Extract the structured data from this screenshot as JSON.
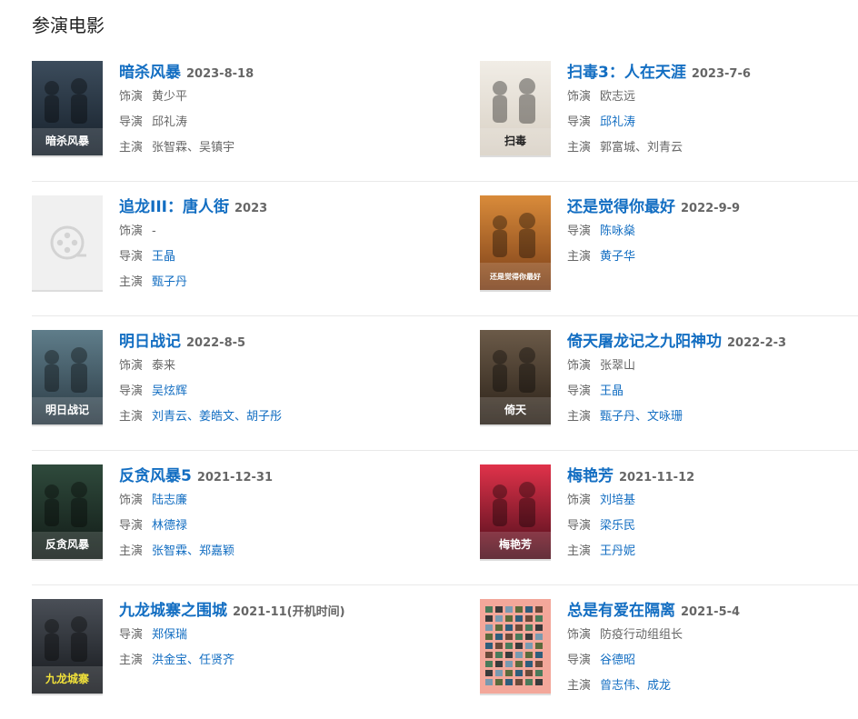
{
  "section": {
    "title": "参演电影"
  },
  "movies": [
    {
      "title": "暗杀风暴",
      "date": "2023-8-18",
      "lines": [
        {
          "label": "饰演",
          "value": "黄少平",
          "kind": "plain"
        },
        {
          "label": "导演",
          "value": "邱礼涛",
          "kind": "plain"
        },
        {
          "label": "主演",
          "value": "张智霖、吴镇宇",
          "kind": "plain"
        }
      ],
      "poster": {
        "kind": "dark",
        "colors": [
          "#3c4c5c",
          "#16202a"
        ],
        "text": "暗杀风暴",
        "text_color": "#ffffff"
      }
    },
    {
      "title": "扫毒3：人在天涯",
      "date": "2023-7-6",
      "lines": [
        {
          "label": "饰演",
          "value": "欧志远",
          "kind": "plain"
        },
        {
          "label": "导演",
          "value": "邱礼涛",
          "kind": "link"
        },
        {
          "label": "主演",
          "value": "郭富城、刘青云",
          "kind": "plain"
        }
      ],
      "poster": {
        "kind": "light",
        "colors": [
          "#f1ede6",
          "#d8d0c4"
        ],
        "text": "扫毒",
        "text_color": "#222222"
      }
    },
    {
      "title": "追龙III：唐人街",
      "date": "2023",
      "lines": [
        {
          "label": "饰演",
          "value": "-",
          "kind": "plain"
        },
        {
          "label": "导演",
          "value": "王晶",
          "kind": "link"
        },
        {
          "label": "主演",
          "value": "甄子丹",
          "kind": "link"
        }
      ],
      "poster": {
        "kind": "placeholder",
        "colors": [
          "#f0f0f0",
          "#f0f0f0"
        ],
        "icon": "film-reel-icon"
      }
    },
    {
      "title": "还是觉得你最好",
      "date": "2022-9-9",
      "lines": [
        {
          "label": "导演",
          "value": "陈咏燊",
          "kind": "link"
        },
        {
          "label": "主演",
          "value": "黄子华",
          "kind": "link"
        }
      ],
      "poster": {
        "kind": "warm",
        "colors": [
          "#d98b3a",
          "#7a3e18"
        ],
        "text": "还是觉得你最好",
        "text_color": "#ffffff"
      }
    },
    {
      "title": "明日战记",
      "date": "2022-8-5",
      "lines": [
        {
          "label": "饰演",
          "value": "泰来",
          "kind": "plain"
        },
        {
          "label": "导演",
          "value": "吴炫辉",
          "kind": "link"
        },
        {
          "label": "主演",
          "value": "刘青云、姜皓文、胡子彤",
          "kind": "link"
        }
      ],
      "poster": {
        "kind": "sci",
        "colors": [
          "#5f7d8a",
          "#2b3a44"
        ],
        "text": "明日战记",
        "text_color": "#ffffff"
      }
    },
    {
      "title": "倚天屠龙记之九阳神功",
      "date": "2022-2-3",
      "lines": [
        {
          "label": "饰演",
          "value": "张翠山",
          "kind": "plain"
        },
        {
          "label": "导演",
          "value": "王晶",
          "kind": "link"
        },
        {
          "label": "主演",
          "value": "甄子丹、文咏珊",
          "kind": "link"
        }
      ],
      "poster": {
        "kind": "epic",
        "colors": [
          "#6b5a48",
          "#2a2118"
        ],
        "text": "倚天",
        "text_color": "#ffffff"
      }
    },
    {
      "title": "反贪风暴5",
      "date": "2021-12-31",
      "lines": [
        {
          "label": "饰演",
          "value": "陆志廉",
          "kind": "link"
        },
        {
          "label": "导演",
          "value": "林德禄",
          "kind": "link"
        },
        {
          "label": "主演",
          "value": "张智霖、郑嘉颖",
          "kind": "link"
        }
      ],
      "poster": {
        "kind": "dark",
        "colors": [
          "#2f4a3c",
          "#111a16"
        ],
        "text": "反贪风暴",
        "text_color": "#ffffff"
      }
    },
    {
      "title": "梅艳芳",
      "date": "2021-11-12",
      "lines": [
        {
          "label": "饰演",
          "value": "刘培基",
          "kind": "link"
        },
        {
          "label": "导演",
          "value": "梁乐民",
          "kind": "link"
        },
        {
          "label": "主演",
          "value": "王丹妮",
          "kind": "link"
        }
      ],
      "poster": {
        "kind": "red",
        "colors": [
          "#e0324a",
          "#4a0d1a"
        ],
        "text": "梅艳芳",
        "text_color": "#ffffff"
      }
    },
    {
      "title": "九龙城寨之围城",
      "date": "2021-11(开机时间)",
      "lines": [
        {
          "label": "导演",
          "value": "郑保瑞",
          "kind": "link"
        },
        {
          "label": "主演",
          "value": "洪金宝、任贤齐",
          "kind": "link"
        }
      ],
      "poster": {
        "kind": "city",
        "colors": [
          "#4a4f57",
          "#15181c"
        ],
        "text": "九龙城寨",
        "text_color": "#f2e23a"
      }
    },
    {
      "title": "总是有爱在隔离",
      "date": "2021-5-4",
      "lines": [
        {
          "label": "饰演",
          "value": "防疫行动组组长",
          "kind": "plain"
        },
        {
          "label": "导演",
          "value": "谷德昭",
          "kind": "link"
        },
        {
          "label": "主演",
          "value": "曾志伟、成龙",
          "kind": "link"
        }
      ],
      "poster": {
        "kind": "grid",
        "colors": [
          "#f3a79a",
          "#f3a79a"
        ],
        "text": "",
        "text_color": "#ffffff"
      }
    }
  ]
}
